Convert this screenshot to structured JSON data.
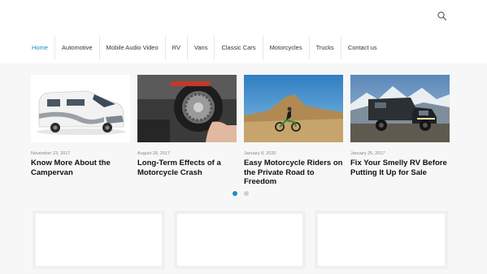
{
  "nav": {
    "items": [
      {
        "label": "Home"
      },
      {
        "label": "Automotive"
      },
      {
        "label": "Mobile Audio Video"
      },
      {
        "label": "RV"
      },
      {
        "label": "Vans"
      },
      {
        "label": "Classic Cars"
      },
      {
        "label": "Motorcycles"
      },
      {
        "label": "Trucks"
      },
      {
        "label": "Contact us"
      }
    ]
  },
  "posts": [
    {
      "date": "November 23, 2017",
      "title": "Know More About the Campervan"
    },
    {
      "date": "August 28, 2017",
      "title": "Long-Term Effects of a Motorcycle Crash"
    },
    {
      "date": "January 8, 2020",
      "title": "Easy Motorcycle Riders on the Private Road to Freedom"
    },
    {
      "date": "January 25, 2017",
      "title": "Fix Your Smelly RV Before Putting It Up for Sale"
    }
  ],
  "slider": {
    "page": 1,
    "pages": 2
  },
  "colors": {
    "accent": "#1a8fc9"
  }
}
